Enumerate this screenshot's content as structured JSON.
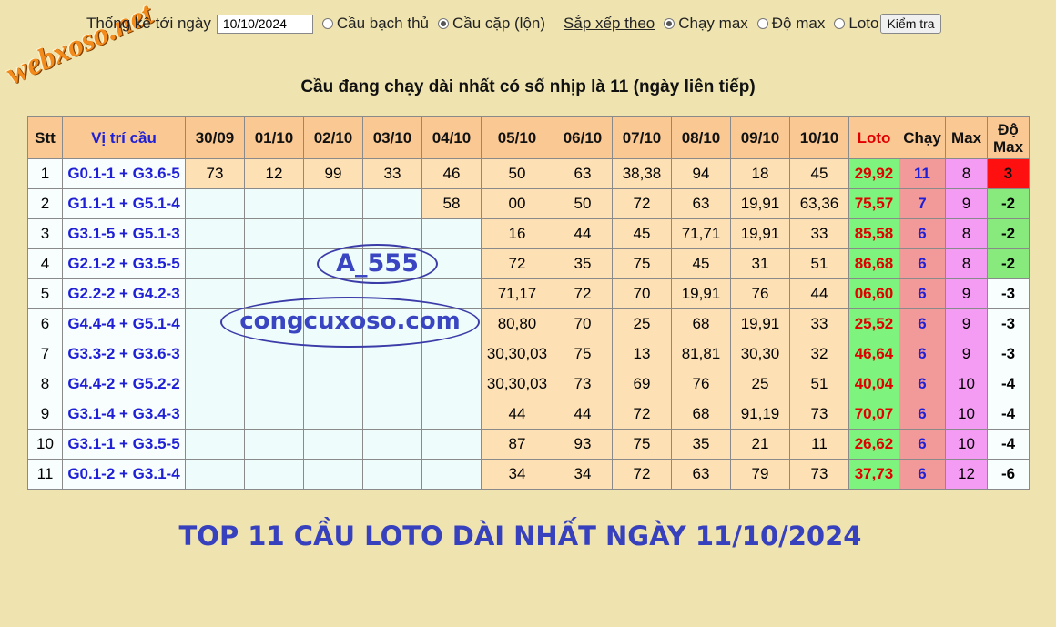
{
  "logo": "webxoso.net",
  "toolbar": {
    "date_label": "Thống kê tới ngày",
    "date_value": "10/10/2024",
    "mode_options": [
      {
        "label": "Cầu bạch thủ",
        "selected": false
      },
      {
        "label": "Cầu cặp (lộn)",
        "selected": true
      }
    ],
    "sort_label": "Sắp xếp theo",
    "sort_options": [
      {
        "label": "Chạy max",
        "selected": true
      },
      {
        "label": "Độ max",
        "selected": false
      },
      {
        "label": "Loto",
        "selected": false
      }
    ],
    "check_button": "Kiểm tra"
  },
  "heading": "Cầu đang chạy dài nhất có số nhịp là 11 (ngày liên tiếp)",
  "table": {
    "headers": {
      "stt": "Stt",
      "position": "Vị trí cầu",
      "dates": [
        "30/09",
        "01/10",
        "02/10",
        "03/10",
        "04/10",
        "05/10",
        "06/10",
        "07/10",
        "08/10",
        "09/10",
        "10/10"
      ],
      "loto": "Loto",
      "chay": "Chạy",
      "max": "Max",
      "do_max_line1": "Độ",
      "do_max_line2": "Max"
    },
    "rows": [
      {
        "stt": "1",
        "position": "G0.1-1 + G3.6-5",
        "values": [
          "73",
          "12",
          "99",
          "33",
          "46",
          "50",
          "63",
          "38,38",
          "94",
          "18",
          "45"
        ],
        "loto": "29,92",
        "chay": "11",
        "max": "8",
        "do_max": "3",
        "do_color": "red"
      },
      {
        "stt": "2",
        "position": "G1.1-1 + G5.1-4",
        "values": [
          "",
          "",
          "",
          "",
          "58",
          "00",
          "50",
          "72",
          "63",
          "19,91",
          "63,36"
        ],
        "loto": "75,57",
        "chay": "7",
        "max": "9",
        "do_max": "-2",
        "do_color": "green"
      },
      {
        "stt": "3",
        "position": "G3.1-5 + G5.1-3",
        "values": [
          "",
          "",
          "",
          "",
          "",
          "16",
          "44",
          "45",
          "71,71",
          "19,91",
          "33"
        ],
        "loto": "85,58",
        "chay": "6",
        "max": "8",
        "do_max": "-2",
        "do_color": "green"
      },
      {
        "stt": "4",
        "position": "G2.1-2 + G3.5-5",
        "values": [
          "",
          "",
          "",
          "",
          "",
          "72",
          "35",
          "75",
          "45",
          "31",
          "51"
        ],
        "loto": "86,68",
        "chay": "6",
        "max": "8",
        "do_max": "-2",
        "do_color": "green"
      },
      {
        "stt": "5",
        "position": "G2.2-2 + G4.2-3",
        "values": [
          "",
          "",
          "",
          "",
          "",
          "71,17",
          "72",
          "70",
          "19,91",
          "76",
          "44"
        ],
        "loto": "06,60",
        "chay": "6",
        "max": "9",
        "do_max": "-3",
        "do_color": "white"
      },
      {
        "stt": "6",
        "position": "G4.4-4 + G5.1-4",
        "values": [
          "",
          "",
          "",
          "",
          "",
          "80,80",
          "70",
          "25",
          "68",
          "19,91",
          "33"
        ],
        "loto": "25,52",
        "chay": "6",
        "max": "9",
        "do_max": "-3",
        "do_color": "white"
      },
      {
        "stt": "7",
        "position": "G3.3-2 + G3.6-3",
        "values": [
          "",
          "",
          "",
          "",
          "",
          "30,30,03",
          "75",
          "13",
          "81,81",
          "30,30",
          "32"
        ],
        "loto": "46,64",
        "chay": "6",
        "max": "9",
        "do_max": "-3",
        "do_color": "white"
      },
      {
        "stt": "8",
        "position": "G4.4-2 + G5.2-2",
        "values": [
          "",
          "",
          "",
          "",
          "",
          "30,30,03",
          "73",
          "69",
          "76",
          "25",
          "51"
        ],
        "loto": "40,04",
        "chay": "6",
        "max": "10",
        "do_max": "-4",
        "do_color": "white"
      },
      {
        "stt": "9",
        "position": "G3.1-4 + G3.4-3",
        "values": [
          "",
          "",
          "",
          "",
          "",
          "44",
          "44",
          "72",
          "68",
          "91,19",
          "73"
        ],
        "loto": "70,07",
        "chay": "6",
        "max": "10",
        "do_max": "-4",
        "do_color": "white"
      },
      {
        "stt": "10",
        "position": "G3.1-1 + G3.5-5",
        "values": [
          "",
          "",
          "",
          "",
          "",
          "87",
          "93",
          "75",
          "35",
          "21",
          "11"
        ],
        "loto": "26,62",
        "chay": "6",
        "max": "10",
        "do_max": "-4",
        "do_color": "white"
      },
      {
        "stt": "11",
        "position": "G0.1-2 + G3.1-4",
        "values": [
          "",
          "",
          "",
          "",
          "",
          "34",
          "34",
          "72",
          "63",
          "79",
          "73"
        ],
        "loto": "37,73",
        "chay": "6",
        "max": "12",
        "do_max": "-6",
        "do_color": "white"
      }
    ]
  },
  "watermarks": {
    "author": "A_555",
    "site": "congcuxoso.com"
  },
  "footer": "TOP 11 CẦU LOTO DÀI NHẤT NGÀY 11/10/2024"
}
